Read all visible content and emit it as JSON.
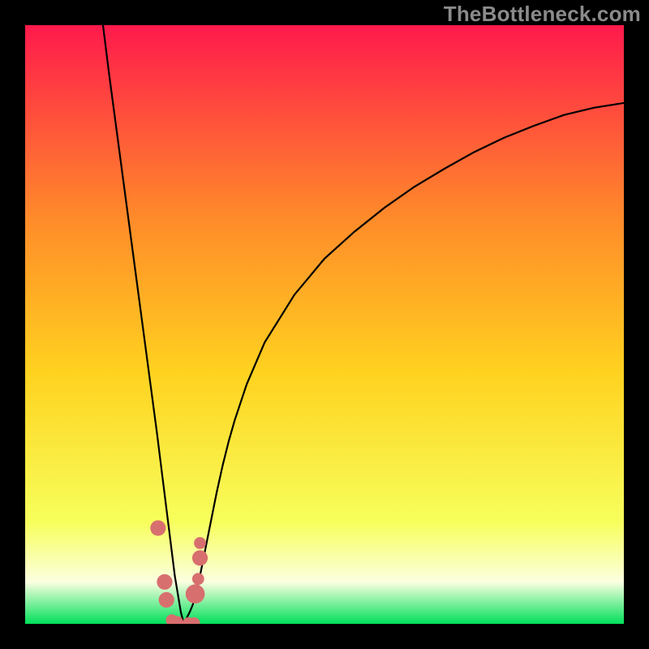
{
  "watermark": "TheBottleneck.com",
  "colors": {
    "frame": "#000000",
    "grad_top": "#ff1a4c",
    "grad_upper": "#ff8a2a",
    "grad_mid": "#ffd21f",
    "grad_lower": "#f7ff5c",
    "grad_pale": "#fbffe0",
    "grad_green": "#00e05a",
    "curve": "#000000",
    "markers": "#d86f6f"
  },
  "chart_data": {
    "type": "line",
    "title": "",
    "xlabel": "",
    "ylabel": "",
    "xlim": [
      0,
      100
    ],
    "ylim": [
      0,
      100
    ],
    "x_optimum": 26.5,
    "series": [
      {
        "name": "bottleneck-curve",
        "note": "y = 100 at x≈13 (left wall), y→0 at x≈26.5, y rises toward ~87 at x=100 (right tail)",
        "x": [
          13.0,
          14.0,
          15.0,
          16.0,
          17.0,
          18.0,
          19.0,
          20.0,
          21.0,
          22.0,
          23.0,
          23.5,
          24.0,
          24.5,
          25.0,
          25.5,
          26.0,
          26.5,
          27.0,
          27.5,
          28.0,
          28.5,
          29.0,
          29.5,
          30.0,
          31.0,
          32.0,
          33.0,
          34.0,
          35.0,
          37.0,
          40.0,
          45.0,
          50.0,
          55.0,
          60.0,
          65.0,
          70.0,
          75.0,
          80.0,
          85.0,
          90.0,
          95.0,
          100.0
        ],
        "y": [
          100.0,
          92.0,
          84.5,
          77.0,
          69.5,
          62.0,
          54.5,
          47.0,
          39.5,
          32.0,
          24.0,
          20.0,
          16.0,
          12.0,
          8.0,
          5.0,
          2.0,
          0.0,
          1.0,
          2.0,
          3.2,
          5.0,
          7.0,
          9.5,
          12.0,
          17.0,
          22.0,
          26.5,
          30.5,
          34.0,
          40.0,
          47.0,
          55.0,
          61.0,
          65.5,
          69.5,
          73.0,
          76.0,
          78.8,
          81.2,
          83.2,
          85.0,
          86.2,
          87.0
        ]
      }
    ],
    "markers": [
      {
        "x": 22.2,
        "y": 16.0,
        "r": 1.3
      },
      {
        "x": 23.3,
        "y": 7.0,
        "r": 1.3
      },
      {
        "x": 23.6,
        "y": 4.0,
        "r": 1.3
      },
      {
        "x": 24.5,
        "y": 0.6,
        "r": 1.0
      },
      {
        "x": 25.4,
        "y": 0.3,
        "r": 1.0
      },
      {
        "x": 27.3,
        "y": 0.1,
        "r": 1.0
      },
      {
        "x": 28.2,
        "y": 0.1,
        "r": 1.0
      },
      {
        "x": 28.4,
        "y": 5.0,
        "r": 1.6
      },
      {
        "x": 28.9,
        "y": 7.5,
        "r": 1.0
      },
      {
        "x": 29.2,
        "y": 11.0,
        "r": 1.3
      },
      {
        "x": 29.2,
        "y": 13.5,
        "r": 1.0
      }
    ]
  }
}
